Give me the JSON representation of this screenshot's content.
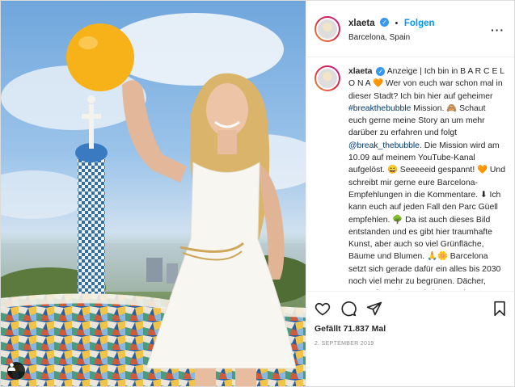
{
  "post": {
    "username": "xlaeta",
    "follow_label": "Folgen",
    "separator": "•",
    "location": "Barcelona, Spain",
    "more_label": "···"
  },
  "caption": {
    "username": "xlaeta",
    "text_1": "Anzeige | Ich bin in B A R C E L O N A ",
    "heart_emoji": "🧡",
    "text_2": " Wer von euch war schon mal in dieser Stadt? Ich bin hier auf geheimer ",
    "hashtag": "#breakthebubble",
    "text_3": " Mission. 🙈 Schaut euch gerne meine Story an um mehr darüber zu erfahren und folgt ",
    "mention": "@break_thebubble",
    "text_4": ". Die Mission wird am 10.09 auf meinem YouTube-Kanal aufgelöst. 😄 Seeeeeid gespannt! 🧡 Und schreibt mir gerne eure Barcelona-Empfehlungen in die Kommentare. ⬇ Ich kann euch auf jeden Fall den Parc Güell empfehlen. 🌳 Da ist auch dieses Bild entstanden und es gibt hier traumhafte Kunst, aber auch so viel Grünfläche, Bäume und Blumen. 🙏🌼 Barcelona setzt sich gerade dafür ein alles bis 2030 noch viel mehr zu begrünen. Dächer, Häuserfassaden und vieles mehr."
  },
  "engagement": {
    "likes": "Gefällt 71.837 Mal",
    "date": "2. SEPTEMBER 2019"
  },
  "colors": {
    "accent": "#0095f6",
    "verified": "#3897f0",
    "balloon": "#f7b21a"
  },
  "icons": [
    "heart-icon",
    "comment-icon",
    "share-icon",
    "bookmark-icon",
    "user-tag-icon",
    "verified-icon"
  ]
}
